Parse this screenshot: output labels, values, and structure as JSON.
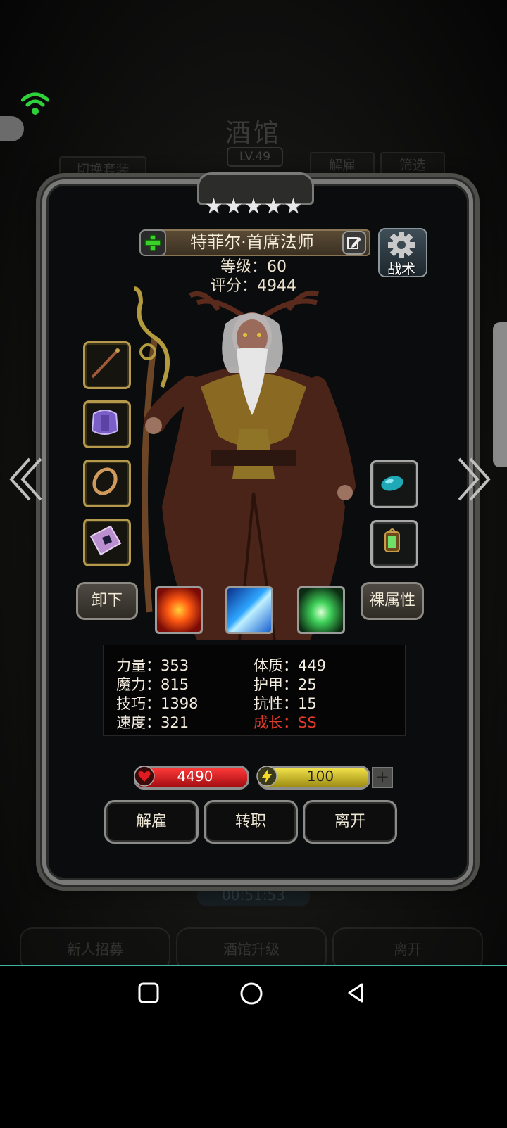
{
  "background": {
    "title": "酒馆",
    "level": "LV.49",
    "switch_outfit": "切换套装",
    "dismiss": "解雇",
    "filter": "筛选",
    "timer": "00:51:53",
    "bottom_buttons": [
      "新人招募",
      "酒馆升级",
      "离开"
    ]
  },
  "hero": {
    "stars": 5,
    "name": "特菲尔·首席法师",
    "level_text": "等级：60",
    "score_text": "评分：4944",
    "tactics_label": "战术"
  },
  "buttons": {
    "unequip": "卸下",
    "bare_attr": "裸属性"
  },
  "stats": {
    "strength": "力量：353",
    "magic": "魔力：815",
    "skill": "技巧：1398",
    "speed": "速度：321",
    "constitution": "体质：449",
    "armor": "护甲：25",
    "resistance": "抗性：15",
    "growth": "成长：SS"
  },
  "bars": {
    "hp": "4490",
    "energy": "100"
  },
  "actions": [
    "解雇",
    "转职",
    "离开"
  ],
  "colors": {
    "gold_frame": "#b59a4e",
    "hp_red": "#d3151d",
    "energy_yellow": "#d8c323",
    "growth_red": "#e23a2a"
  },
  "icons": [
    "wifi-icon",
    "plus-icon",
    "edit-icon",
    "gear-icon",
    "chevron-left-icon",
    "chevron-right-icon",
    "heart-icon",
    "lightning-icon",
    "square-icon",
    "circle-icon",
    "triangle-back-icon"
  ]
}
